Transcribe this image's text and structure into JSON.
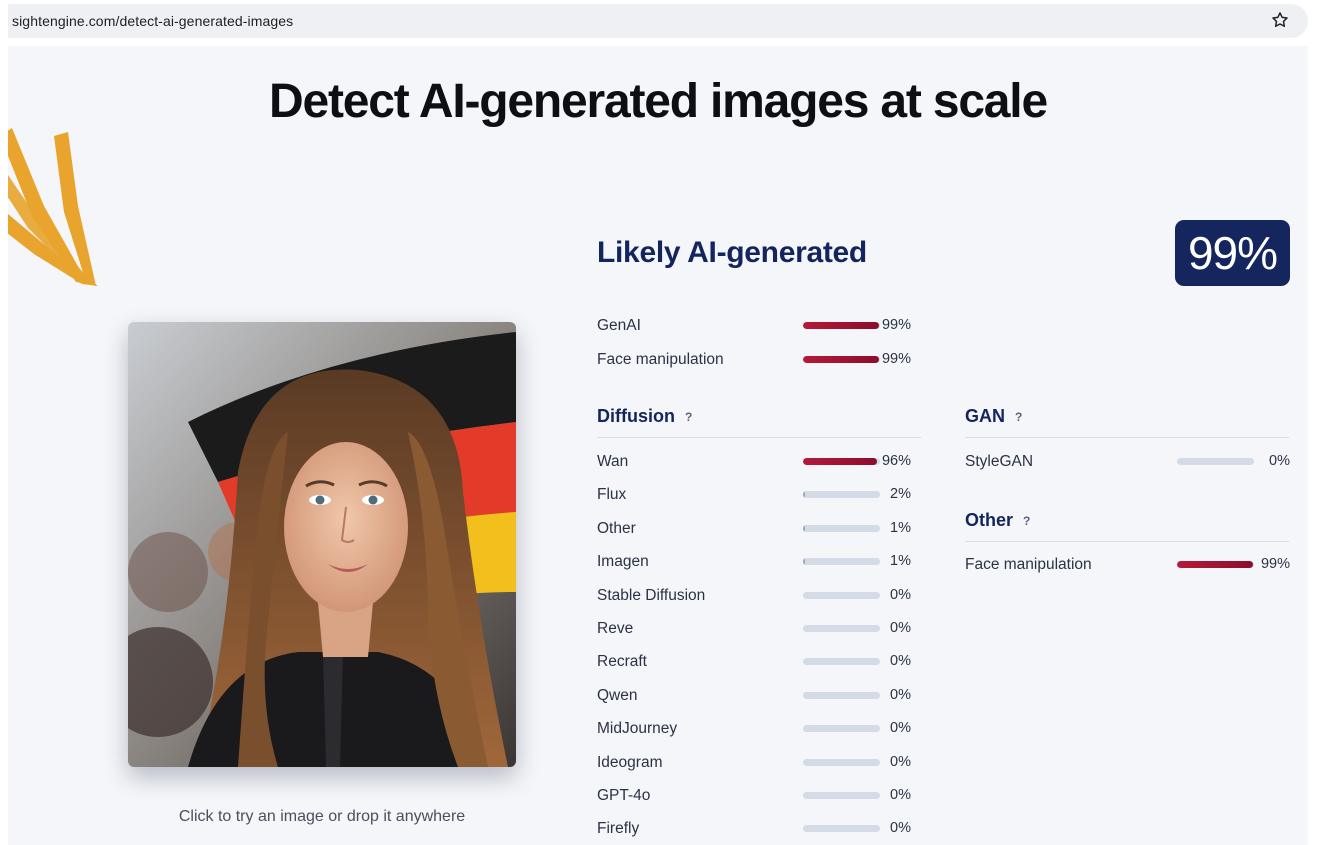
{
  "browser": {
    "url": "sightengine.com/detect-ai-generated-images"
  },
  "page": {
    "title": "Detect AI-generated images at scale",
    "caption": "Click to try an image or drop it anywhere"
  },
  "result": {
    "verdict": "Likely AI-generated",
    "score_text": "99%",
    "summary": [
      {
        "label": "GenAI",
        "value": 99,
        "value_text": "99%"
      },
      {
        "label": "Face manipulation",
        "value": 99,
        "value_text": "99%"
      }
    ],
    "diffusion": {
      "title": "Diffusion",
      "help": "?",
      "rows": [
        {
          "label": "Wan",
          "value": 96,
          "value_text": "96%"
        },
        {
          "label": "Flux",
          "value": 2,
          "value_text": "2%"
        },
        {
          "label": "Other",
          "value": 1,
          "value_text": "1%"
        },
        {
          "label": "Imagen",
          "value": 1,
          "value_text": "1%"
        },
        {
          "label": "Stable Diffusion",
          "value": 0,
          "value_text": "0%"
        },
        {
          "label": "Reve",
          "value": 0,
          "value_text": "0%"
        },
        {
          "label": "Recraft",
          "value": 0,
          "value_text": "0%"
        },
        {
          "label": "Qwen",
          "value": 0,
          "value_text": "0%"
        },
        {
          "label": "MidJourney",
          "value": 0,
          "value_text": "0%"
        },
        {
          "label": "Ideogram",
          "value": 0,
          "value_text": "0%"
        },
        {
          "label": "GPT-4o",
          "value": 0,
          "value_text": "0%"
        },
        {
          "label": "Firefly",
          "value": 0,
          "value_text": "0%"
        }
      ]
    },
    "gan": {
      "title": "GAN",
      "help": "?",
      "rows": [
        {
          "label": "StyleGAN",
          "value": 0,
          "value_text": "0%"
        }
      ]
    },
    "other": {
      "title": "Other",
      "help": "?",
      "rows": [
        {
          "label": "Face manipulation",
          "value": 99,
          "value_text": "99%"
        }
      ]
    }
  },
  "icons": {
    "bookmark": "star-icon",
    "decoration": "brush-stroke-arrow"
  },
  "colors": {
    "accent_navy": "#15255e",
    "bar_high": "#a8143a",
    "bar_track": "#d3dbe6",
    "decoration": "#e8a42c"
  }
}
